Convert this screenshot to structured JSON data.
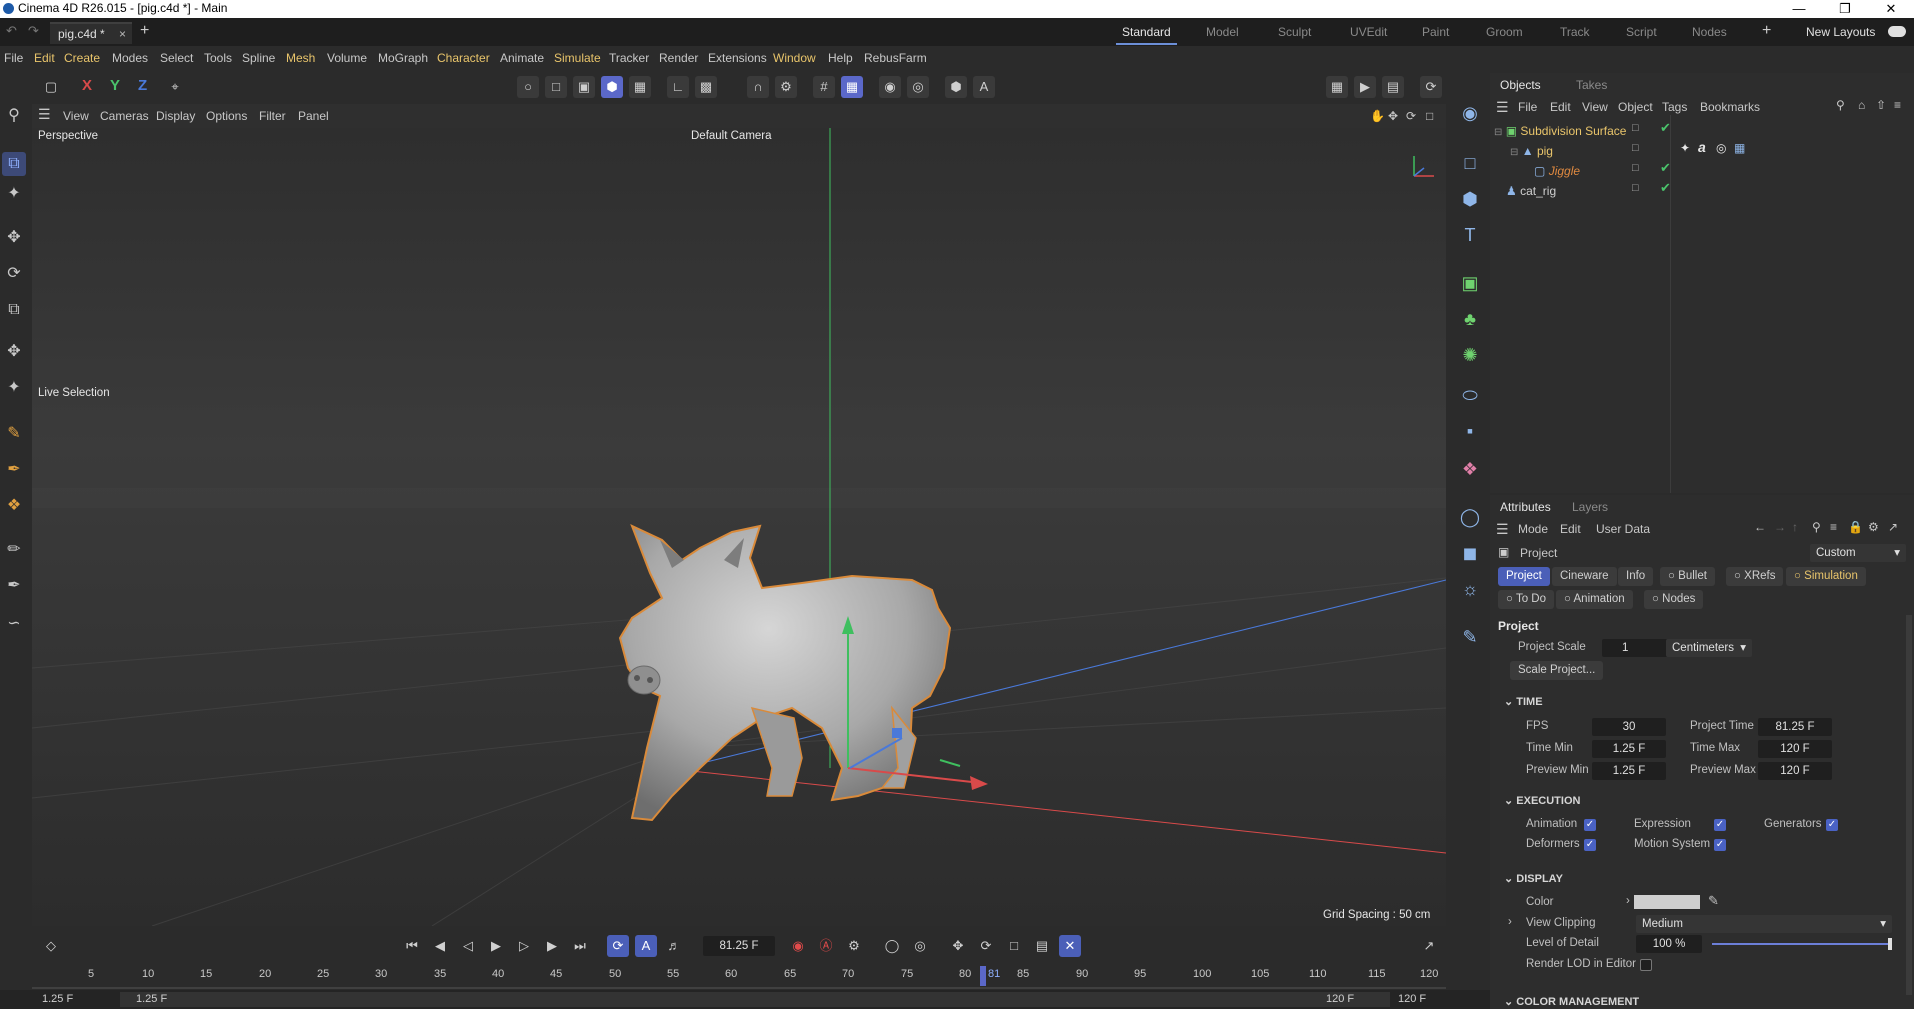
{
  "window": {
    "title": "Cinema 4D R26.015 - [pig.c4d *] - Main",
    "doc_tab": "pig.c4d *"
  },
  "layouts": [
    "Standard",
    "Model",
    "Sculpt",
    "UVEdit",
    "Paint",
    "Groom",
    "Track",
    "Script",
    "Nodes"
  ],
  "new_layouts": "New Layouts",
  "menu": [
    "File",
    "Edit",
    "Create",
    "Modes",
    "Select",
    "Tools",
    "Spline",
    "Mesh",
    "Volume",
    "MoGraph",
    "Character",
    "Animate",
    "Simulate",
    "Tracker",
    "Render",
    "Extensions",
    "Window",
    "Help",
    "RebusFarm"
  ],
  "axes": {
    "x": "X",
    "y": "Y",
    "z": "Z"
  },
  "viewport": {
    "menu": [
      "View",
      "Cameras",
      "Display",
      "Options",
      "Filter",
      "Panel"
    ],
    "label": "Perspective",
    "camera": "Default Camera",
    "tool": "Live Selection",
    "grid_spacing": "Grid Spacing : 50 cm",
    "bg_color": "#3a3a3a"
  },
  "objects_panel": {
    "tabs": [
      "Objects",
      "Takes"
    ],
    "menu": [
      "File",
      "Edit",
      "View",
      "Object",
      "Tags",
      "Bookmarks"
    ],
    "items": [
      {
        "name": "Subdivision Surface"
      },
      {
        "name": "pig"
      },
      {
        "name": "Jiggle"
      },
      {
        "name": "cat_rig"
      }
    ]
  },
  "attributes_panel": {
    "tabs": [
      "Attributes",
      "Layers"
    ],
    "menu": [
      "Mode",
      "Edit",
      "User Data"
    ],
    "object": "Project",
    "mode_select": "Custom",
    "sub_tabs_row1": [
      "Project",
      "Cineware",
      "Info",
      "Bullet",
      "XRefs",
      "Simulation"
    ],
    "sub_tabs_row2": [
      "To Do",
      "Animation",
      "Nodes"
    ],
    "section_title": "Project",
    "project_scale_label": "Project Scale",
    "project_scale": "1",
    "units": "Centimeters",
    "scale_project_btn": "Scale Project...",
    "time": {
      "header": "TIME",
      "fps_label": "FPS",
      "fps": "30",
      "project_time_label": "Project Time",
      "project_time": "81.25 F",
      "time_min_label": "Time Min",
      "time_min": "1.25 F",
      "time_max_label": "Time Max",
      "time_max": "120 F",
      "preview_min_label": "Preview Min",
      "preview_min": "1.25 F",
      "preview_max_label": "Preview Max",
      "preview_max": "120 F"
    },
    "execution": {
      "header": "EXECUTION",
      "animation": "Animation",
      "expression": "Expression",
      "generators": "Generators",
      "deformers": "Deformers",
      "motion_system": "Motion System"
    },
    "display": {
      "header": "DISPLAY",
      "color_label": "Color",
      "view_clipping_label": "View Clipping",
      "view_clipping": "Medium",
      "lod_label": "Level of Detail",
      "lod": "100 %",
      "render_lod_label": "Render LOD in Editor"
    },
    "color_management": "COLOR MANAGEMENT"
  },
  "timeline": {
    "current_frame": "81.25 F",
    "ticks": [
      "5",
      "10",
      "15",
      "20",
      "25",
      "30",
      "35",
      "40",
      "45",
      "50",
      "55",
      "60",
      "65",
      "70",
      "75",
      "80",
      "81",
      "85",
      "90",
      "95",
      "100",
      "105",
      "110",
      "115",
      "120"
    ],
    "bottom_left_a": "1.25 F",
    "bottom_left_b": "1.25 F",
    "bottom_right_a": "120 F",
    "bottom_right_b": "120 F"
  },
  "colors": {
    "accent": "#5b68c9",
    "selected_object": "#e9c56b",
    "pig_outline": "#d98a3a",
    "axis_x": "#d94a4a",
    "axis_y": "#4ac26b",
    "axis_z": "#4a79d9"
  }
}
